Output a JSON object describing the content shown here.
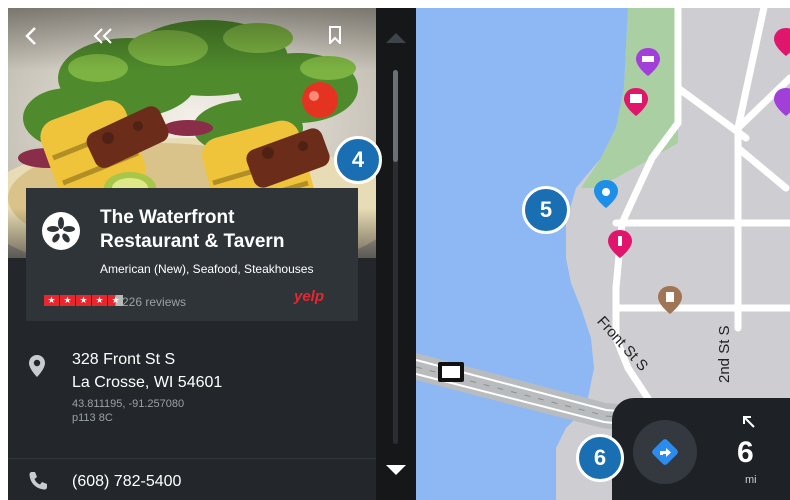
{
  "business": {
    "name_line1": "The Waterfront",
    "name_line2": "Restaurant & Tavern",
    "categories": "American (New), Seafood, Steakhouses",
    "rating": 4.5,
    "reviews": "226 reviews",
    "provider": "yelp"
  },
  "address": {
    "line1": "328 Front St S",
    "line2": "La Crosse, WI 54601",
    "coords": "43.811195, -91.257080",
    "code": "p113 8C"
  },
  "phone": "(608) 782-5400",
  "map": {
    "street_front": "Front St S",
    "street_2nd": "2nd St S"
  },
  "distance": {
    "value": "6",
    "unit": "mi"
  },
  "badges": {
    "b4": "4",
    "b5": "5",
    "b6": "6"
  },
  "icons": {
    "back": "chevron-left-icon",
    "collapse": "double-chevron-left-icon",
    "bookmark": "bookmark-icon",
    "pin": "location-pin-icon",
    "phone": "phone-icon",
    "navigate": "navigate-diamond-icon",
    "turn": "turn-arrow-icon"
  },
  "colors": {
    "panel_bg": "#23272b",
    "water": "#8db8f3",
    "land": "#cecdd2",
    "accent": "#1a6fb3",
    "yelp_red": "#e8262d",
    "nav_blue": "#2a8cf0"
  }
}
